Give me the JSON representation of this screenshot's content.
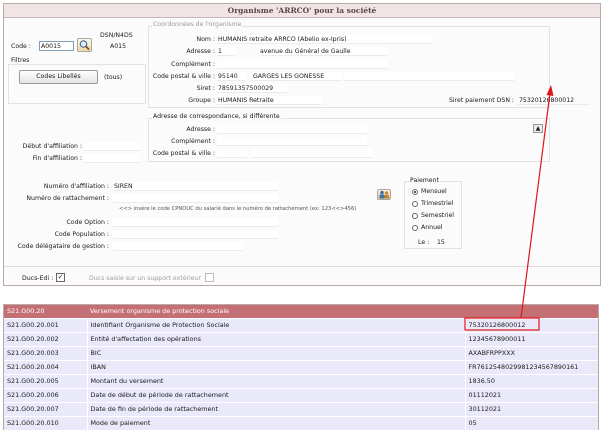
{
  "window": {
    "title": "Organisme 'ARRCO' pour la société"
  },
  "left_panel": {
    "code_label": "Code :",
    "code_value": "A0015",
    "dsn_label": "DSN/N4DS",
    "dsn_value": "A015",
    "filters_label": "Filtres",
    "codes_button_label": "Codes Libellés",
    "tous_label": "(tous)",
    "debut_affiliation_label": "Début d'affiliation :",
    "fin_affiliation_label": "Fin d'affiliation :"
  },
  "organisme": {
    "legend": "Coordonnées de l'organisme",
    "nom_label": "Nom :",
    "nom_value": "HUMANIS retraite ARRCO (Abelio ex-Ipris)",
    "adresse_label": "Adresse :",
    "adresse_num": "1",
    "adresse_value": "avenue du Général de Gaulle",
    "complement_label": "Complément :",
    "cp_ville_label": "Code postal & ville :",
    "cp_value": "95140",
    "ville_value": "GARGES LES GONESSE",
    "siret_label": "Siret :",
    "siret_value": "78591357500029",
    "groupe_label": "Groupe :",
    "groupe_value": "HUMANIS Retraite",
    "siret_paiement_label": "Siret paiement DSN :",
    "siret_paiement_value": "75320126800012"
  },
  "correspondance": {
    "legend": "Adresse de correspondance, si différente",
    "adresse_label": "Adresse :",
    "complement_label": "Complément :",
    "cp_ville_label": "Code postal & ville :"
  },
  "affiliation": {
    "numero_label": "Numéro d'affiliation :",
    "numero_value": "SIREN",
    "rattachement_label": "Numéro de rattachement :",
    "hint": "<<> insère le code CPNOUC du salarié dans le numéro de rattachement (ex: 123<<>456)",
    "code_option_label": "Code Option :",
    "code_population_label": "Code Population :",
    "code_delegataire_label": "Code délégataire de gestion :"
  },
  "paiement": {
    "legend": "Paiement",
    "options": [
      "Mensuel",
      "Trimestriel",
      "Semestriel",
      "Annuel"
    ],
    "selected": "Mensuel",
    "le_label": "Le :",
    "le_value": "15"
  },
  "footer": {
    "ducs_edi_label": "Ducs-Edi :",
    "ducs_support_label": "Ducs saisie sur un support extérieur"
  },
  "dsn_table": {
    "header": {
      "code": "S21.G00.20",
      "label": "Versement organisme de protection sociale",
      "value": ""
    },
    "rows": [
      {
        "code": "S21.G00.20.001",
        "label": "Identifiant Organisme de Protection Sociale",
        "value": "75320126800012"
      },
      {
        "code": "S21.G00.20.002",
        "label": "Entité d'affectation des opérations",
        "value": "12345678900011"
      },
      {
        "code": "S21.G00.20.003",
        "label": "BIC",
        "value": "AXABFRPPXXX"
      },
      {
        "code": "S21.G00.20.004",
        "label": "IBAN",
        "value": "FR7612548029981234567890161"
      },
      {
        "code": "S21.G00.20.005",
        "label": "Montant du versement",
        "value": "1836.50"
      },
      {
        "code": "S21.G00.20.006",
        "label": "Date de début de période de rattachement",
        "value": "01112021"
      },
      {
        "code": "S21.G00.20.007",
        "label": "Date de fin de période de rattachement",
        "value": "30112021"
      },
      {
        "code": "S21.G00.20.010",
        "label": "Mode de paiement",
        "value": "05"
      }
    ]
  },
  "colors": {
    "title_bg": "#f1e4e4",
    "table_header_bg": "#c46f74",
    "table_row_bg": "#e9e9f9",
    "highlight": "#e0151a"
  }
}
